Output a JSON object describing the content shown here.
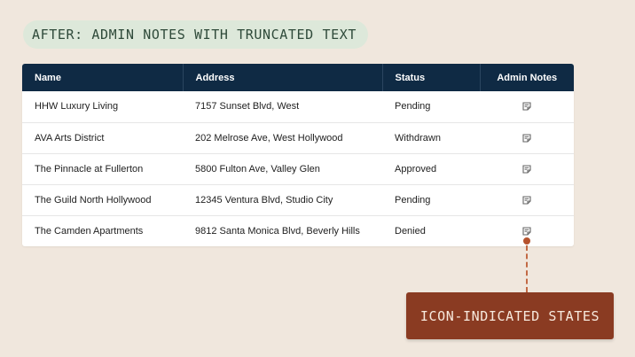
{
  "caption": "AFTER: ADMIN NOTES WITH TRUNCATED TEXT",
  "table": {
    "headers": [
      "Name",
      "Address",
      "Status",
      "Admin Notes"
    ],
    "rows": [
      {
        "name": "HHW Luxury Living",
        "address": "7157 Sunset Blvd, West",
        "status": "Pending",
        "notes_icon": "note-icon"
      },
      {
        "name": "AVA Arts District",
        "address": "202 Melrose Ave, West Hollywood",
        "status": "Withdrawn",
        "notes_icon": "note-icon"
      },
      {
        "name": "The Pinnacle at Fullerton",
        "address": "5800 Fulton Ave, Valley Glen",
        "status": "Approved",
        "notes_icon": "note-icon"
      },
      {
        "name": "The Guild North Hollywood",
        "address": "12345 Ventura Blvd, Studio City",
        "status": "Pending",
        "notes_icon": "note-icon"
      },
      {
        "name": "The Camden Apartments",
        "address": "9812 Santa Monica Blvd, Beverly Hills",
        "status": "Denied",
        "notes_icon": "note-icon"
      }
    ]
  },
  "callout": {
    "label": "ICON-INDICATED STATES"
  },
  "colors": {
    "background": "#f0e7dd",
    "header": "#0f2a44",
    "caption_bg": "#dde8da",
    "callout_bg": "#8a3b22",
    "accent": "#b5522d"
  }
}
